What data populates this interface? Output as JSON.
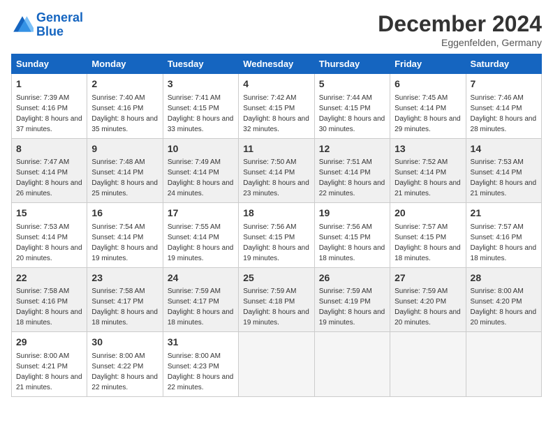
{
  "header": {
    "logo_line1": "General",
    "logo_line2": "Blue",
    "month": "December 2024",
    "location": "Eggenfelden, Germany"
  },
  "weekdays": [
    "Sunday",
    "Monday",
    "Tuesday",
    "Wednesday",
    "Thursday",
    "Friday",
    "Saturday"
  ],
  "weeks": [
    [
      {
        "day": "1",
        "rise": "7:39 AM",
        "set": "4:16 PM",
        "dh": "8 hours and 37 minutes."
      },
      {
        "day": "2",
        "rise": "7:40 AM",
        "set": "4:16 PM",
        "dh": "8 hours and 35 minutes."
      },
      {
        "day": "3",
        "rise": "7:41 AM",
        "set": "4:15 PM",
        "dh": "8 hours and 33 minutes."
      },
      {
        "day": "4",
        "rise": "7:42 AM",
        "set": "4:15 PM",
        "dh": "8 hours and 32 minutes."
      },
      {
        "day": "5",
        "rise": "7:44 AM",
        "set": "4:15 PM",
        "dh": "8 hours and 30 minutes."
      },
      {
        "day": "6",
        "rise": "7:45 AM",
        "set": "4:14 PM",
        "dh": "8 hours and 29 minutes."
      },
      {
        "day": "7",
        "rise": "7:46 AM",
        "set": "4:14 PM",
        "dh": "8 hours and 28 minutes."
      }
    ],
    [
      {
        "day": "8",
        "rise": "7:47 AM",
        "set": "4:14 PM",
        "dh": "8 hours and 26 minutes."
      },
      {
        "day": "9",
        "rise": "7:48 AM",
        "set": "4:14 PM",
        "dh": "8 hours and 25 minutes."
      },
      {
        "day": "10",
        "rise": "7:49 AM",
        "set": "4:14 PM",
        "dh": "8 hours and 24 minutes."
      },
      {
        "day": "11",
        "rise": "7:50 AM",
        "set": "4:14 PM",
        "dh": "8 hours and 23 minutes."
      },
      {
        "day": "12",
        "rise": "7:51 AM",
        "set": "4:14 PM",
        "dh": "8 hours and 22 minutes."
      },
      {
        "day": "13",
        "rise": "7:52 AM",
        "set": "4:14 PM",
        "dh": "8 hours and 21 minutes."
      },
      {
        "day": "14",
        "rise": "7:53 AM",
        "set": "4:14 PM",
        "dh": "8 hours and 21 minutes."
      }
    ],
    [
      {
        "day": "15",
        "rise": "7:53 AM",
        "set": "4:14 PM",
        "dh": "8 hours and 20 minutes."
      },
      {
        "day": "16",
        "rise": "7:54 AM",
        "set": "4:14 PM",
        "dh": "8 hours and 19 minutes."
      },
      {
        "day": "17",
        "rise": "7:55 AM",
        "set": "4:14 PM",
        "dh": "8 hours and 19 minutes."
      },
      {
        "day": "18",
        "rise": "7:56 AM",
        "set": "4:15 PM",
        "dh": "8 hours and 19 minutes."
      },
      {
        "day": "19",
        "rise": "7:56 AM",
        "set": "4:15 PM",
        "dh": "8 hours and 18 minutes."
      },
      {
        "day": "20",
        "rise": "7:57 AM",
        "set": "4:15 PM",
        "dh": "8 hours and 18 minutes."
      },
      {
        "day": "21",
        "rise": "7:57 AM",
        "set": "4:16 PM",
        "dh": "8 hours and 18 minutes."
      }
    ],
    [
      {
        "day": "22",
        "rise": "7:58 AM",
        "set": "4:16 PM",
        "dh": "8 hours and 18 minutes."
      },
      {
        "day": "23",
        "rise": "7:58 AM",
        "set": "4:17 PM",
        "dh": "8 hours and 18 minutes."
      },
      {
        "day": "24",
        "rise": "7:59 AM",
        "set": "4:17 PM",
        "dh": "8 hours and 18 minutes."
      },
      {
        "day": "25",
        "rise": "7:59 AM",
        "set": "4:18 PM",
        "dh": "8 hours and 19 minutes."
      },
      {
        "day": "26",
        "rise": "7:59 AM",
        "set": "4:19 PM",
        "dh": "8 hours and 19 minutes."
      },
      {
        "day": "27",
        "rise": "7:59 AM",
        "set": "4:20 PM",
        "dh": "8 hours and 20 minutes."
      },
      {
        "day": "28",
        "rise": "8:00 AM",
        "set": "4:20 PM",
        "dh": "8 hours and 20 minutes."
      }
    ],
    [
      {
        "day": "29",
        "rise": "8:00 AM",
        "set": "4:21 PM",
        "dh": "8 hours and 21 minutes."
      },
      {
        "day": "30",
        "rise": "8:00 AM",
        "set": "4:22 PM",
        "dh": "8 hours and 22 minutes."
      },
      {
        "day": "31",
        "rise": "8:00 AM",
        "set": "4:23 PM",
        "dh": "8 hours and 22 minutes."
      },
      null,
      null,
      null,
      null
    ]
  ]
}
